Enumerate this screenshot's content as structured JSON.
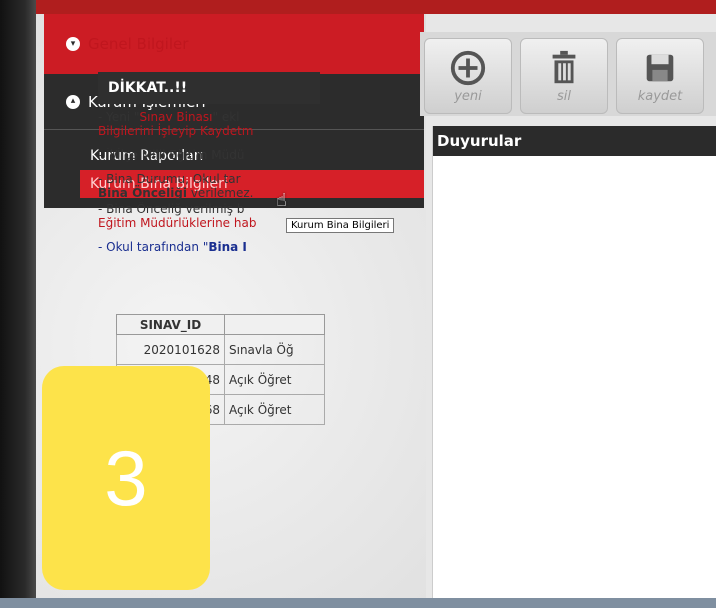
{
  "sidebar": {
    "general_label": "Genel Bilgiler",
    "institution_label": "Kurum İşlemleri",
    "items": [
      {
        "label": "Kurum Raporları"
      },
      {
        "label": "Kurum Bina Bilgileri"
      }
    ]
  },
  "tooltip": "Kurum Bina Bilgileri",
  "badge_number": "3",
  "toolbar": {
    "new_label": "yeni",
    "delete_label": "sil",
    "save_label": "kaydet"
  },
  "content": {
    "title": "Duyurular",
    "notice_title": "DİKKAT..!!",
    "line1_a": "- Yeni \"",
    "line1_red": "Sınav Binası",
    "line1_b": "\" ekl",
    "line1_cont": "Bilgilerini İşleyip Kaydetm",
    "line2": "- İl/İlçe Milli Eğitim Müdü",
    "line3": "- Bina Durumu, Okul tar",
    "line3_bold": "Bina Önceliği",
    "line3_b": " verilemez.",
    "line4": "- Bina Önceliğ verilmiş b",
    "line4_red": "Eğitim Müdürlüklerine hab",
    "line5_a": "- Okul tarafından \"",
    "line5_bold": "Bina I"
  },
  "table": {
    "header_id": "SINAV_ID",
    "rows": [
      {
        "id": "2020101628",
        "name": "Sınavla Öğ"
      },
      {
        "id": "2020051648",
        "name": "Açık Öğret"
      },
      {
        "id": "2020051568",
        "name": "Açık Öğret"
      }
    ]
  },
  "colors": {
    "accent_red": "#cc1c24",
    "menu_dark": "#2c2c2c",
    "badge_yellow": "#fde34a"
  }
}
